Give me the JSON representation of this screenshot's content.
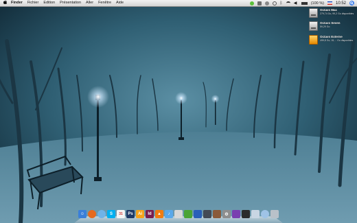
{
  "menu_bar": {
    "apple_icon": "apple-icon",
    "app_name": "Finder",
    "items": [
      "Fichier",
      "Edition",
      "Présentation",
      "Aller",
      "Fenêtre",
      "Aide"
    ],
    "battery": "(100 %)",
    "clock": "10:52"
  },
  "desktop": {
    "drives": [
      {
        "name": "Octavs Mac",
        "info": "279,74 Go, 99,2 Go disponibles",
        "icon": "hard-drive-icon"
      },
      {
        "name": "Octavs Seven",
        "info": "59,29 Go",
        "icon": "hard-drive-icon"
      },
      {
        "name": "Octavs Externe",
        "info": "499,8 Go, 15,... Go disponibles",
        "icon": "external-drive-icon"
      }
    ]
  },
  "dock": {
    "items": [
      {
        "name": "finder",
        "icon": "finder-icon",
        "color": "#3a7fd9",
        "glyph": "☺"
      },
      {
        "name": "firefox",
        "icon": "firefox-icon",
        "color": "#e66a1f",
        "glyph": ""
      },
      {
        "name": "safari",
        "icon": "safari-icon",
        "color": "#6fb3e8",
        "glyph": ""
      },
      {
        "name": "skype",
        "icon": "skype-icon",
        "color": "#00aff0",
        "glyph": "S"
      },
      {
        "name": "calendar",
        "icon": "calendar-icon",
        "color": "#f4f4f4",
        "glyph": "31"
      },
      {
        "name": "photoshop",
        "icon": "photoshop-icon",
        "color": "#1f3a66",
        "glyph": "Ps"
      },
      {
        "name": "illustrator",
        "icon": "illustrator-icon",
        "color": "#f6a21a",
        "glyph": "Ai"
      },
      {
        "name": "indesign",
        "icon": "indesign-icon",
        "color": "#7a1d4e",
        "glyph": "Id"
      },
      {
        "name": "vlc",
        "icon": "vlc-icon",
        "color": "#f07c12",
        "glyph": "▲"
      },
      {
        "name": "itunes",
        "icon": "itunes-icon",
        "color": "#5aa8ea",
        "glyph": "♪"
      },
      {
        "name": "preview",
        "icon": "preview-icon",
        "color": "#d8d8d8",
        "glyph": ""
      },
      {
        "name": "frog-app",
        "icon": "frog-icon",
        "color": "#4aa436",
        "glyph": ""
      },
      {
        "name": "app-blue",
        "icon": "app-icon",
        "color": "#2a5fb8",
        "glyph": ""
      },
      {
        "name": "app-dark",
        "icon": "app-icon",
        "color": "#444a55",
        "glyph": ""
      },
      {
        "name": "app-photo",
        "icon": "photo-icon",
        "color": "#8a5a3a",
        "glyph": ""
      },
      {
        "name": "system-prefs",
        "icon": "gear-icon",
        "color": "#8e8e8e",
        "glyph": "⚙"
      },
      {
        "name": "app-purple",
        "icon": "app-icon",
        "color": "#7a3fb0",
        "glyph": ""
      },
      {
        "name": "terminal",
        "icon": "terminal-icon",
        "color": "#2b2b2b",
        "glyph": ""
      },
      {
        "name": "downloads",
        "icon": "folder-icon",
        "color": "#c9d6e3",
        "glyph": ""
      },
      {
        "name": "cloud",
        "icon": "cloud-icon",
        "color": "#9fc3e6",
        "glyph": ""
      },
      {
        "name": "trash",
        "icon": "trash-icon",
        "color": "#b9c1c9",
        "glyph": ""
      }
    ]
  }
}
